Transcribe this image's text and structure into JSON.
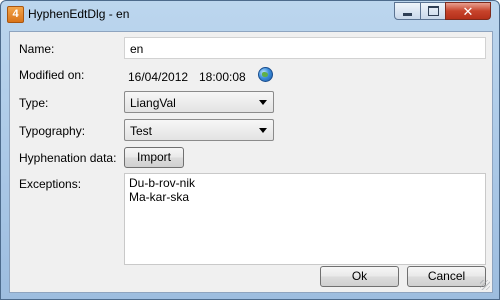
{
  "window": {
    "title": "HyphenEdtDlg - en",
    "app_icon_text": "4"
  },
  "form": {
    "name_label": "Name:",
    "name_value": "en",
    "modified_label": "Modified on:",
    "modified_date": "16/04/2012",
    "modified_time": "18:00:08",
    "type_label": "Type:",
    "type_value": "LiangVal",
    "typography_label": "Typography:",
    "typography_value": "Test",
    "hyphenation_label": "Hyphenation data:",
    "import_button": "Import",
    "exceptions_label": "Exceptions:",
    "exceptions": [
      "Du-b-rov-nik",
      "Ma-kar-ska"
    ]
  },
  "buttons": {
    "ok": "Ok",
    "cancel": "Cancel"
  },
  "icons": {
    "app": "app-icon",
    "globe": "globe-icon",
    "minimize": "minimize-icon",
    "maximize": "maximize-icon",
    "close": "close-icon"
  }
}
